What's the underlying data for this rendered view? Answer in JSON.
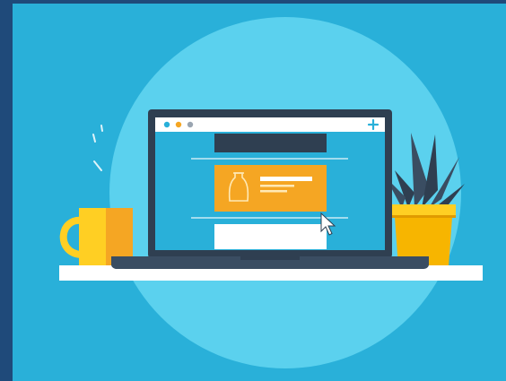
{
  "illustration": {
    "subject": "laptop-on-desk-with-mug-and-plant",
    "colors": {
      "frame": "#1f4a7a",
      "background": "#29b0d9",
      "circle": "#5bd1ee",
      "desk": "#ffffff",
      "laptop_body": "#2f3f51",
      "screen": "#29b0d9",
      "browser_bar": "#ffffff",
      "dot_blue": "#29b0d9",
      "dot_orange": "#f5a623",
      "dot_gray": "#9aa5b1",
      "accent_orange": "#f5a623",
      "mug_yellow": "#ffcf23",
      "plant_leaf": "#2f3f51",
      "pot_yellow": "#f7b500"
    },
    "icons": [
      "plus-icon",
      "cursor-icon",
      "vase-icon",
      "mug-icon",
      "plant-icon"
    ]
  }
}
